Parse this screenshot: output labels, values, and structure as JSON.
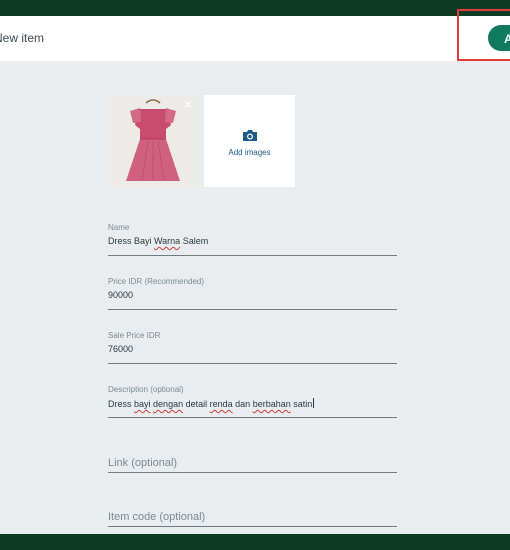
{
  "header": {
    "title": "New item",
    "add_button_label": "Add"
  },
  "images": {
    "thumbnail_alt": "Pink baby dress with ruffles",
    "remove_label": "×",
    "add_images_label": "Add images"
  },
  "form": {
    "name": {
      "label": "Name",
      "value_parts": [
        "Dress Bayi ",
        "Warna",
        " Salem"
      ]
    },
    "price": {
      "label": "Price IDR (Recommended)",
      "value": "90000"
    },
    "sale_price": {
      "label": "Sale Price IDR",
      "value": "76000"
    },
    "description": {
      "label": "Description (optional)",
      "value_parts": [
        "Dress ",
        "bayi",
        " ",
        "dengan",
        " detail ",
        "renda",
        " dan ",
        "berbahan",
        " satin"
      ]
    },
    "link": {
      "placeholder": "Link (optional)"
    },
    "item_code": {
      "placeholder": "Item code (optional)"
    }
  },
  "colors": {
    "header_bar": "#0d3b24",
    "accent_button": "#0f7a5e",
    "highlight": "#e03a3a",
    "link_blue": "#1f5a86"
  }
}
